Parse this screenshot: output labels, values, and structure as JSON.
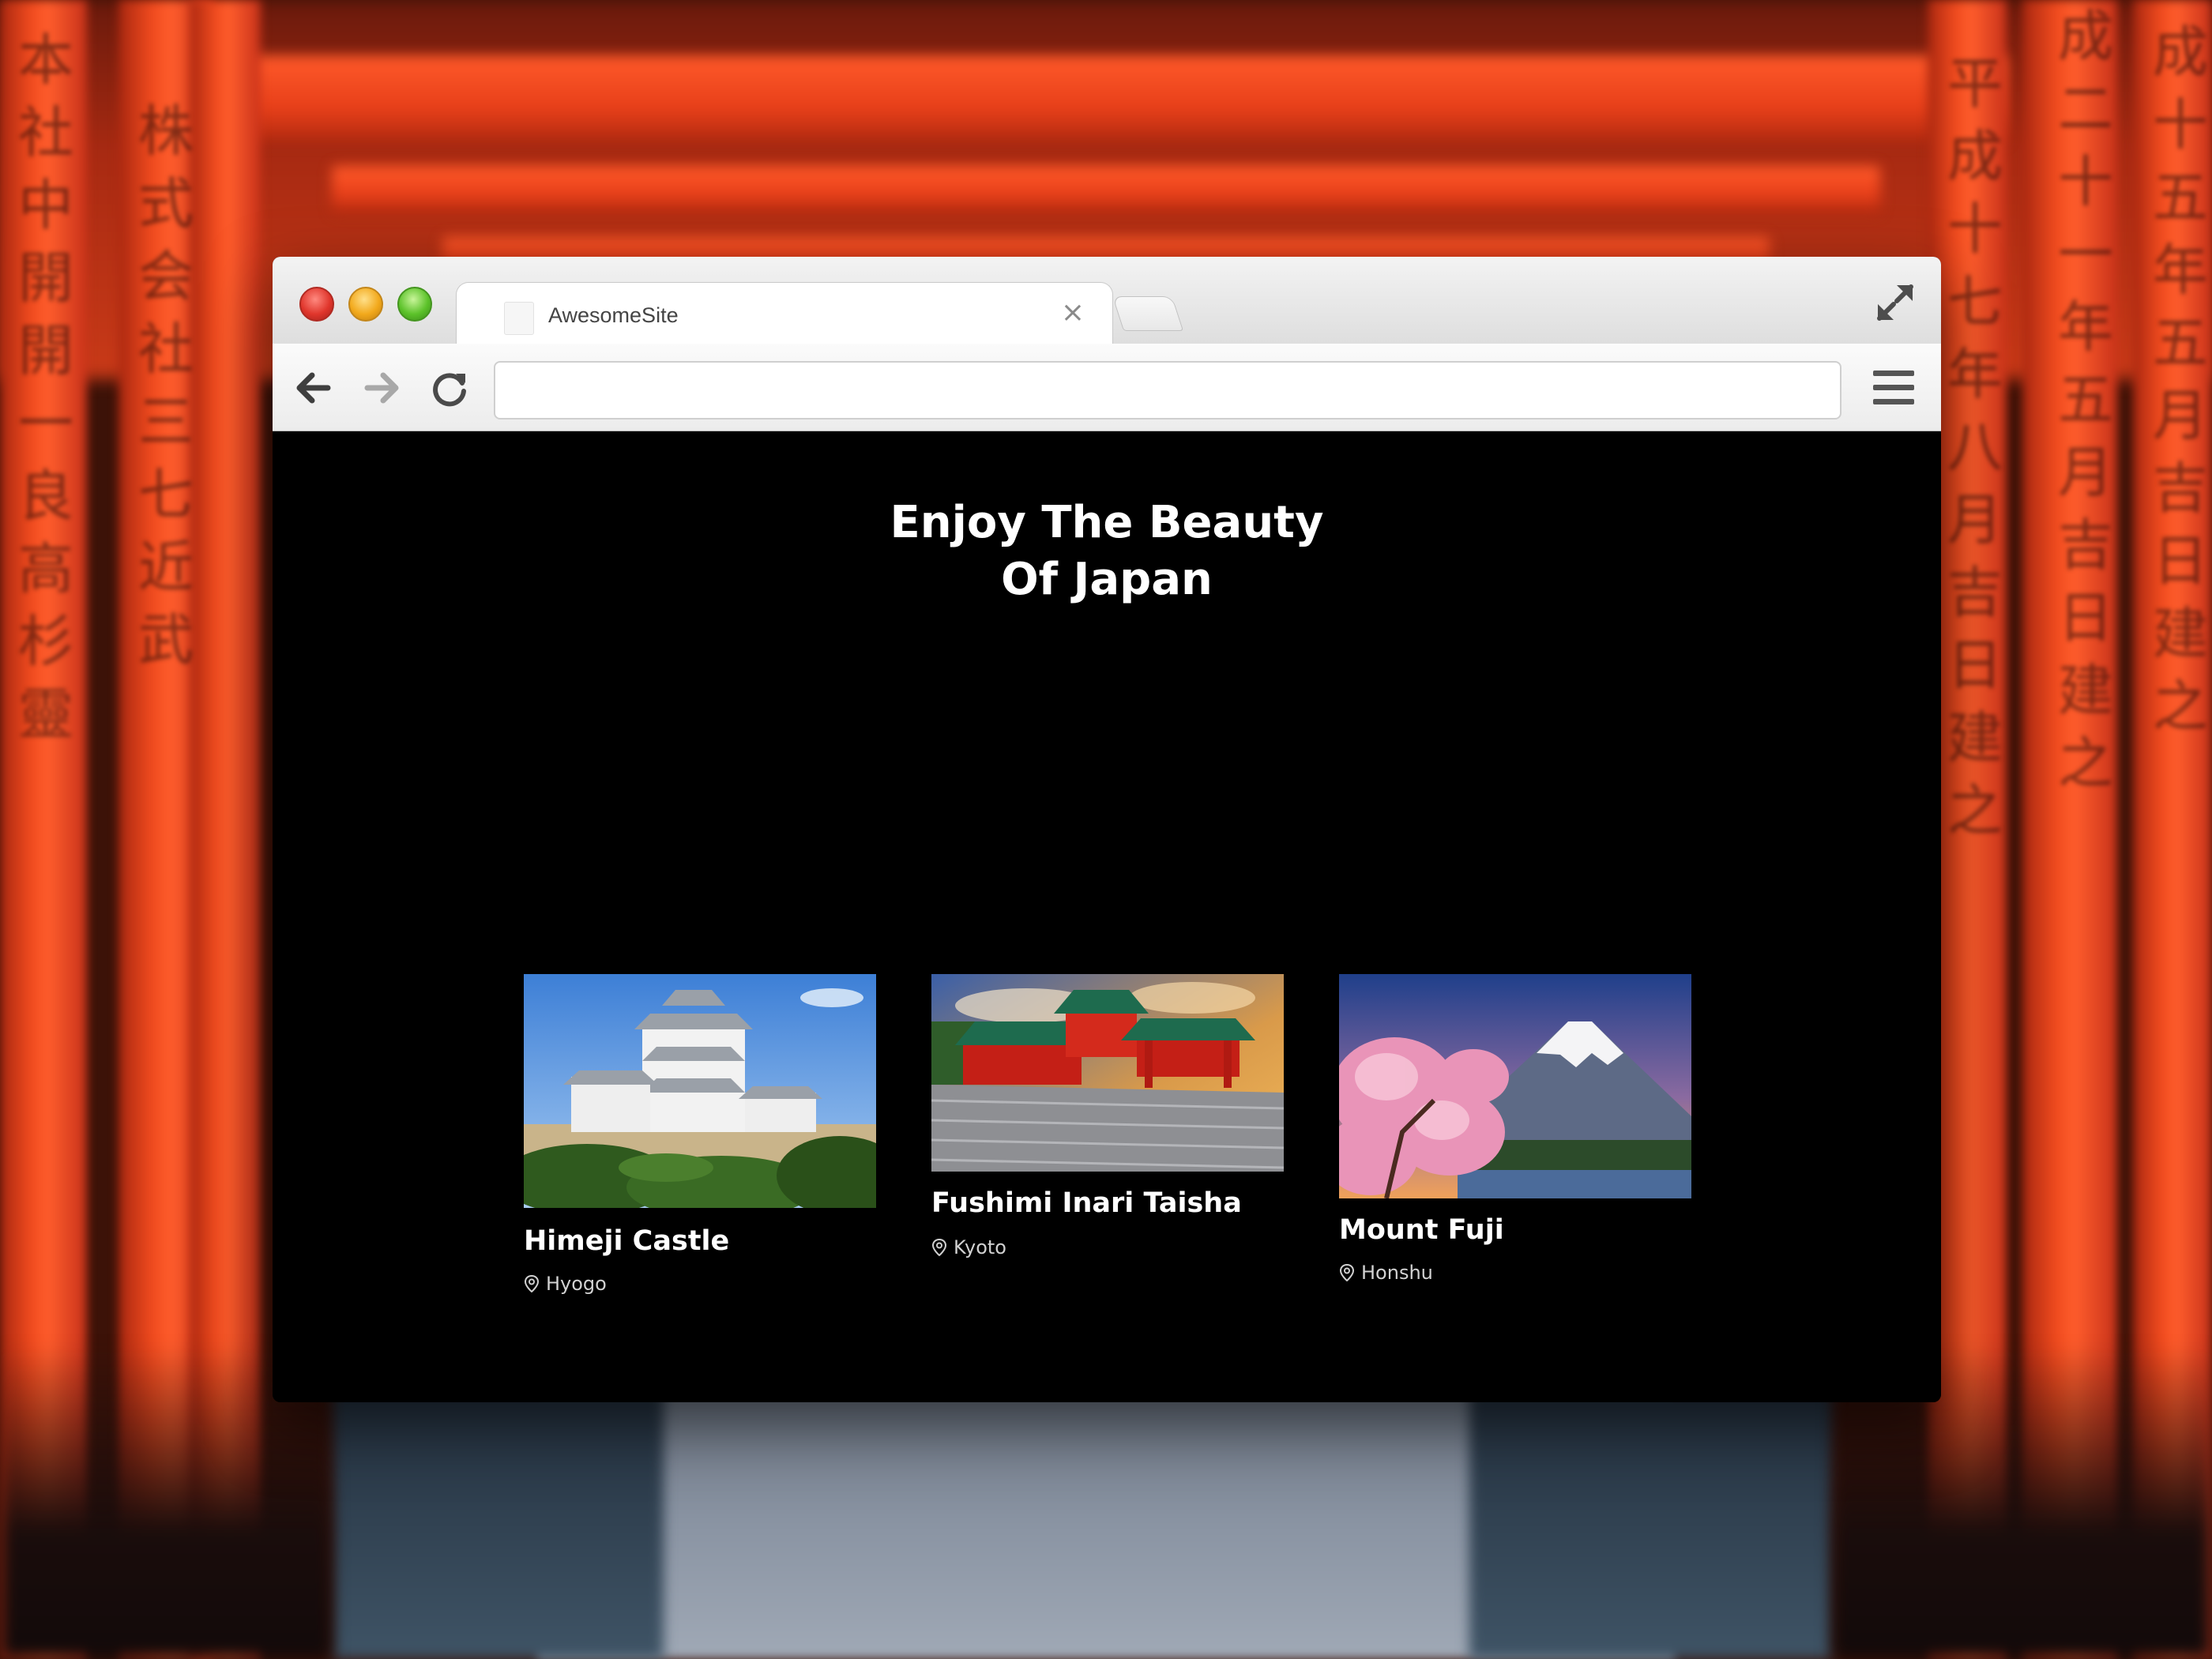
{
  "browser": {
    "tab_title": "AwesomeSite",
    "tab_close_glyph": "×",
    "url_value": "",
    "url_placeholder": ""
  },
  "page": {
    "heading_line1": "Enjoy The Beauty",
    "heading_line2": "Of Japan",
    "cards": [
      {
        "title": "Himeji Castle",
        "location": "Hyogo",
        "image": "castle-photo"
      },
      {
        "title": "Fushimi Inari Taisha",
        "location": "Kyoto",
        "image": "shrine-photo"
      },
      {
        "title": "Mount Fuji",
        "location": "Honshu",
        "image": "mountain-photo"
      }
    ]
  },
  "icons": {
    "back": "arrow-left-icon",
    "forward": "arrow-right-icon",
    "reload": "reload-icon",
    "menu": "hamburger-menu-icon",
    "fullscreen": "fullscreen-icon",
    "location": "map-pin-icon"
  },
  "colors": {
    "page_background": "#000000",
    "heading_text": "#ffffff",
    "location_text": "#d2d2d2",
    "torii_orange": "#ef4a1e"
  }
}
